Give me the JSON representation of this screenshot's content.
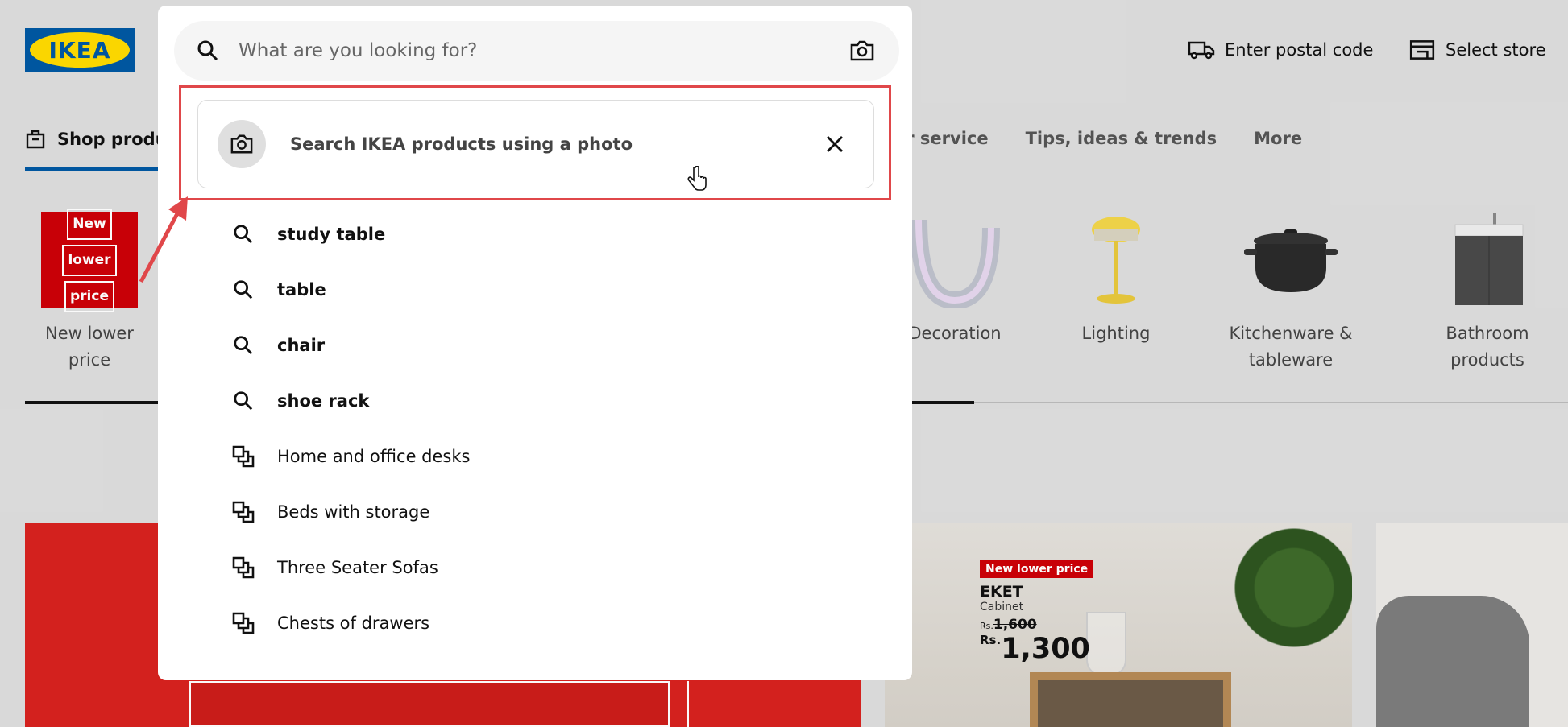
{
  "header": {
    "logo_text": "IKEA",
    "postal": "Enter postal code",
    "store": "Select store"
  },
  "nav": {
    "shop": "Shop produ",
    "items": [
      "er service",
      "Tips, ideas & trends",
      "More"
    ]
  },
  "categories": [
    {
      "label": "New lower price",
      "icon": "new-lower-price-badge",
      "badge": [
        "New",
        "lower",
        "price"
      ]
    },
    {
      "label": "Decoration",
      "icon": "vase-icon"
    },
    {
      "label": "Lighting",
      "icon": "lamp-icon"
    },
    {
      "label": "Kitchenware &",
      "label2": "tableware",
      "icon": "pot-icon"
    },
    {
      "label": "Bathroom products",
      "icon": "bathroom-cabinet-icon"
    }
  ],
  "search": {
    "placeholder": "What are you looking for?",
    "photo_search": "Search IKEA products using a photo",
    "suggestions": [
      {
        "text": "study table",
        "type": "query"
      },
      {
        "text": "table",
        "type": "query"
      },
      {
        "text": "chair",
        "type": "query"
      },
      {
        "text": "shoe rack",
        "type": "query"
      },
      {
        "text": "Home and office desks",
        "type": "category"
      },
      {
        "text": "Beds with storage",
        "type": "category"
      },
      {
        "text": "Three Seater Sofas",
        "type": "category"
      },
      {
        "text": "Chests of drawers",
        "type": "category"
      }
    ]
  },
  "promo": {
    "badge": "New lower price",
    "name": "EKET",
    "sub": "Cabinet",
    "currency": "Rs.",
    "old_price": "1,600",
    "new_price": "1,300"
  },
  "colors": {
    "ikea_blue": "#0058a3",
    "ikea_yellow": "#ffdb00",
    "highlight": "#e0474a",
    "promo_red": "#cc0008"
  }
}
